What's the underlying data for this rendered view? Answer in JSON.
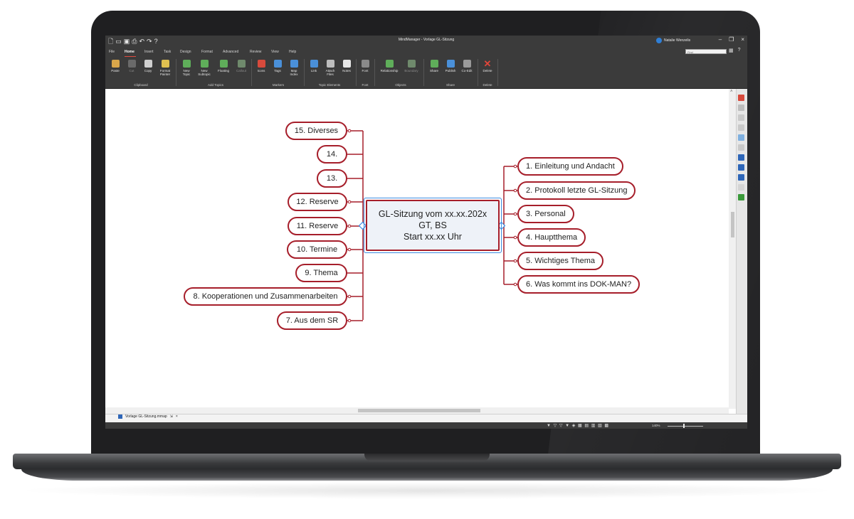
{
  "window": {
    "title": "MindManager - Vorlage GL-Sitzung",
    "user": "Natalie Wenzelis",
    "search_placeholder": "Find"
  },
  "menu": {
    "tabs": [
      "File",
      "Home",
      "Insert",
      "Task",
      "Design",
      "Format",
      "Advanced",
      "Review",
      "View",
      "Help"
    ],
    "active_tab": "Home"
  },
  "ribbon": {
    "buttons": {
      "paste": "Paste",
      "cut": "Cut",
      "copy": "Copy",
      "format_painter": "Format\nPainter",
      "new_topic": "New\nTopic",
      "new_subtopic": "New\nSubtopic",
      "floating": "Floating",
      "callout": "Callout",
      "icons": "Icons",
      "tags": "Tags",
      "map_index": "Map\nIndex",
      "link": "Link",
      "attach_files": "Attach\nFiles",
      "notes": "Notes",
      "font": "Font",
      "relationship": "Relationship",
      "boundary": "Boundary",
      "share": "Share",
      "publish": "Publish",
      "co_edit": "Co-Edit",
      "delete": "Delete"
    },
    "groups": {
      "clipboard": "Clipboard",
      "add_topics": "Add Topics",
      "markers": "Markers",
      "topic_elements": "Topic Elements",
      "font": "Font",
      "objects": "Objects",
      "share": "Share",
      "delete": "Delete"
    }
  },
  "map": {
    "central": {
      "line1": "GL-Sitzung vom xx.xx.202x",
      "line2": "GT, BS",
      "line3": "Start xx.xx Uhr"
    },
    "right_topics": [
      "1. Einleitung und Andacht",
      "2. Protokoll letzte GL-Sitzung",
      "3. Personal",
      "4. Hauptthema",
      "5. Wichtiges Thema",
      "6. Was kommt ins DOK-MAN?"
    ],
    "left_topics": [
      "15. Diverses",
      "14.",
      "13.",
      "12. Reserve",
      "11. Reserve",
      "10. Termine",
      "9. Thema",
      "8. Kooperationen und Zusammenarbeiten",
      "7. Aus dem SR"
    ]
  },
  "document_tab": {
    "filename": "Vorlage GL-Sitzung.mmap"
  },
  "status": {
    "zoom": "140%"
  },
  "colors": {
    "topic_border": "#a61e2a",
    "central_fill": "#eef2f8",
    "selection": "#3d8be0",
    "chrome": "#3b3b3b"
  }
}
